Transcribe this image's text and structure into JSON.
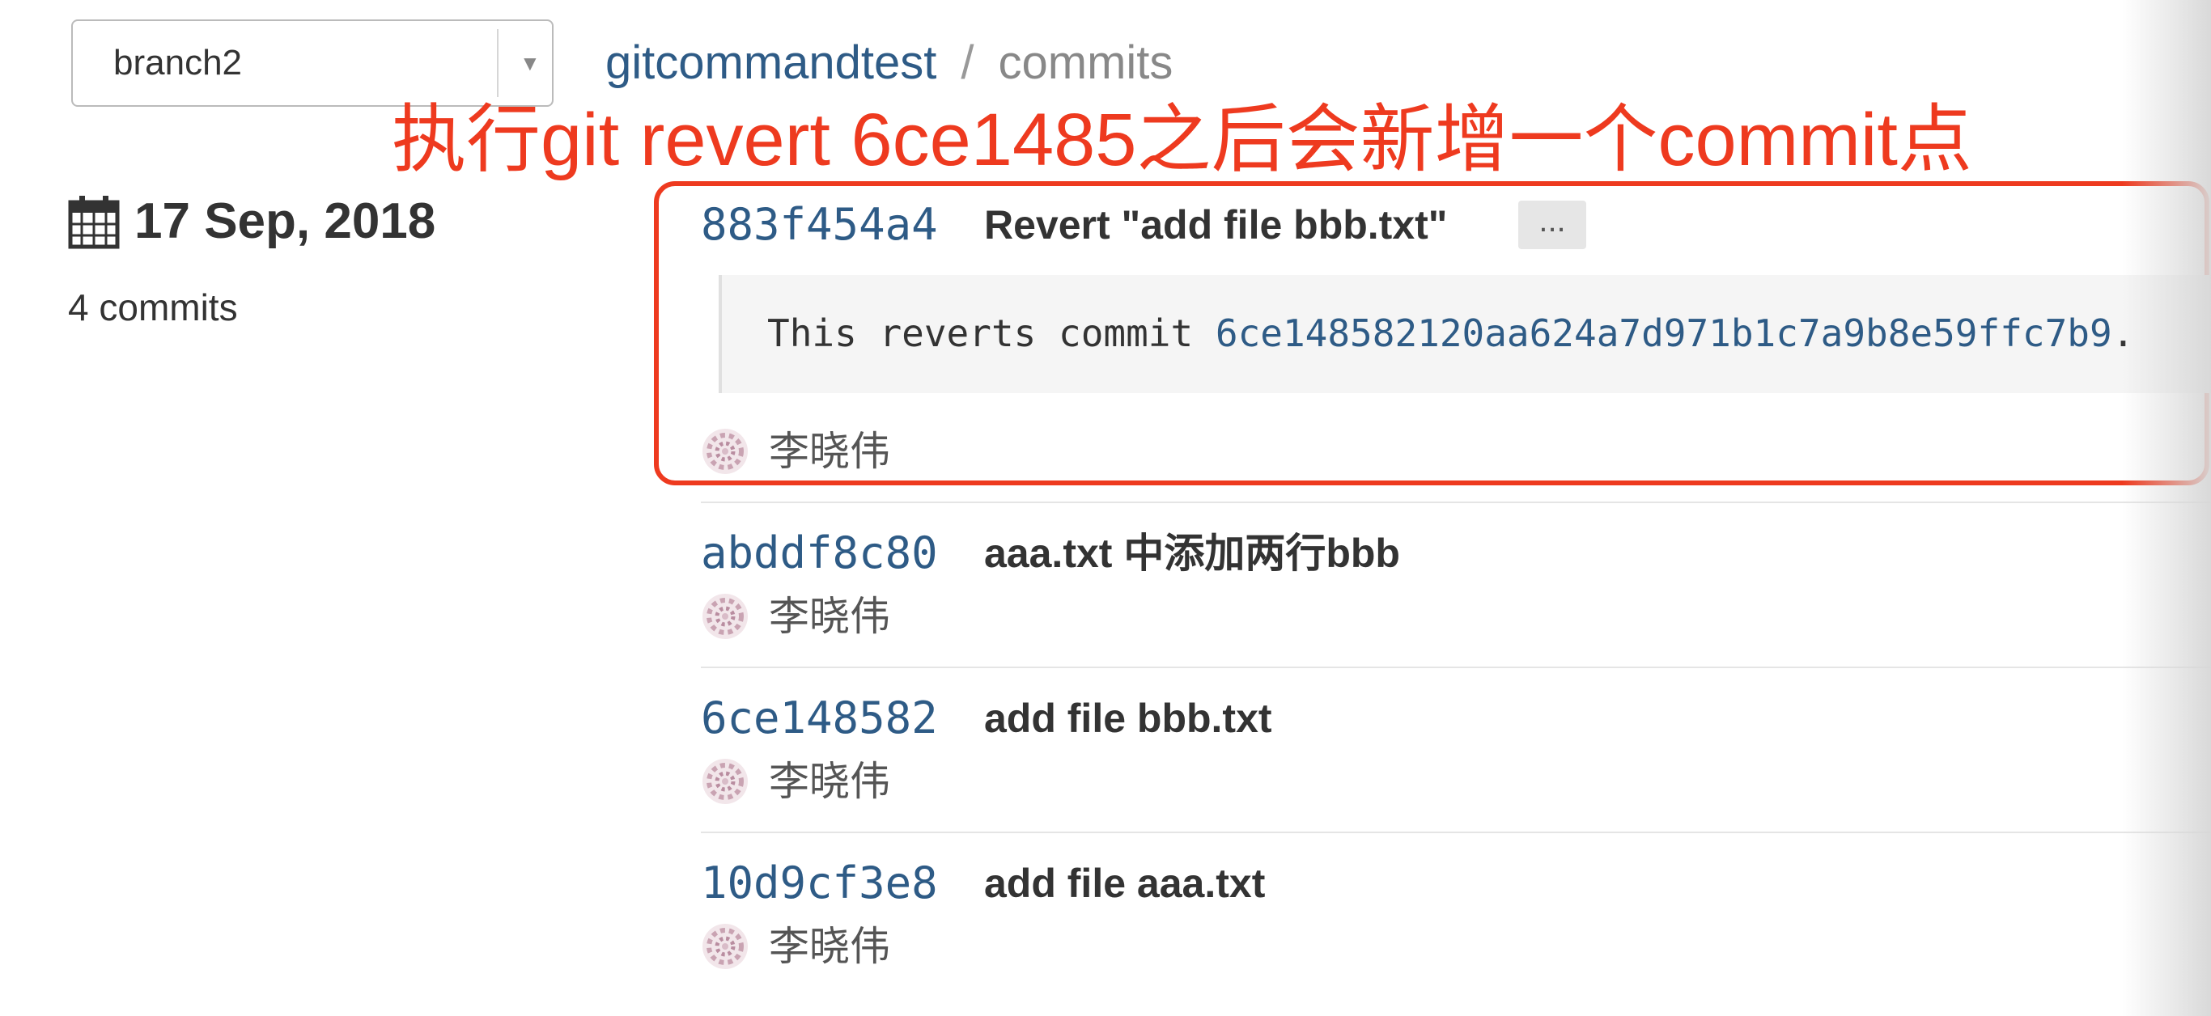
{
  "branch_selector": {
    "value": "branch2"
  },
  "breadcrumb": {
    "repo": "gitcommandtest",
    "separator": "/",
    "current": "commits"
  },
  "annotation": {
    "text": "执行git revert 6ce1485之后会新增一个commit点",
    "color": "#ee3a1f"
  },
  "day_group": {
    "date": "17 Sep, 2018",
    "count": "4 commits"
  },
  "commits": [
    {
      "sha": "883f454a4",
      "title": "Revert \"add file bbb.txt\"",
      "expand_label": "...",
      "message_prefix": "This reverts commit ",
      "message_ref": "6ce148582120aa624a7d971b1c7a9b8e59ffc7b9",
      "message_suffix": ".",
      "author": "李晓伟"
    },
    {
      "sha": "abddf8c80",
      "title": "aaa.txt 中添加两行bbb",
      "author": "李晓伟"
    },
    {
      "sha": "6ce148582",
      "title": "add file bbb.txt",
      "author": "李晓伟"
    },
    {
      "sha": "10d9cf3e8",
      "title": "add file aaa.txt",
      "author": "李晓伟"
    }
  ],
  "colors": {
    "link": "#2e5b86",
    "text": "#333333",
    "annotation": "#ee3a1f"
  },
  "icons": {
    "calendar": "calendar-icon",
    "avatar": "identicon-avatar",
    "caret": "caret-down-icon"
  }
}
